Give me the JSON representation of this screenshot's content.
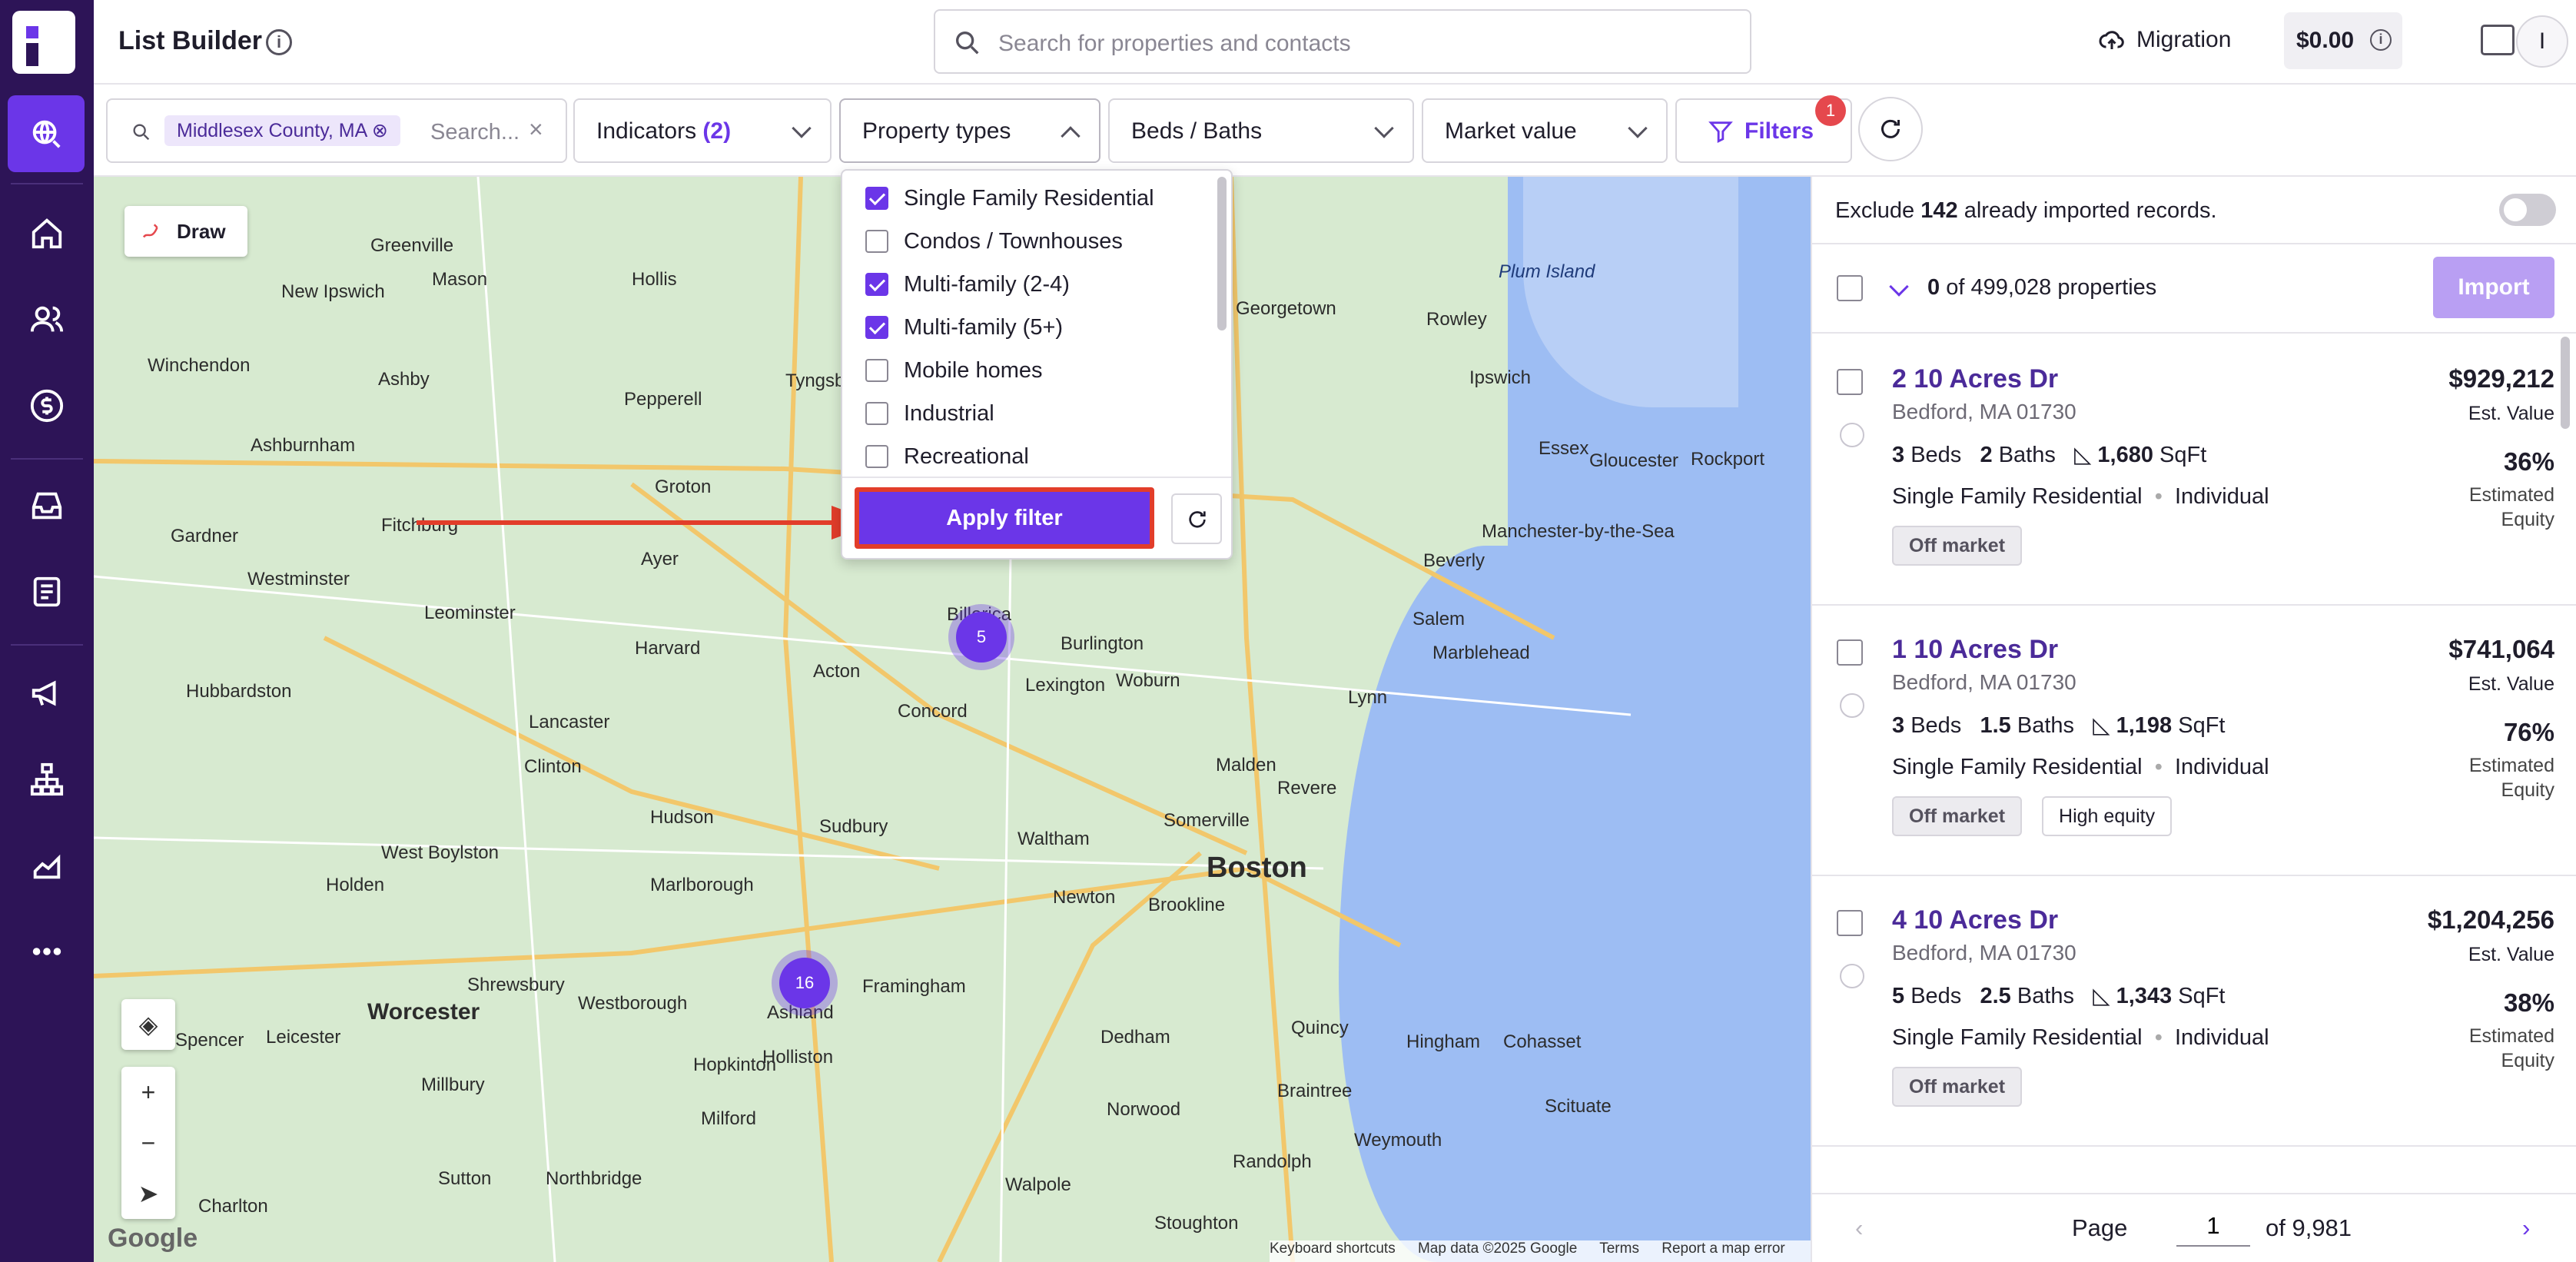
{
  "header": {
    "title": "List Builder",
    "search_placeholder": "Search for properties and contacts",
    "migration_label": "Migration",
    "balance": "$0.00",
    "user_initial": "I"
  },
  "filters": {
    "location_chip": "Middlesex County, MA",
    "location_placeholder": "Search...",
    "indicators_label": "Indicators",
    "indicators_count": "(2)",
    "property_types_label": "Property types",
    "beds_baths_label": "Beds / Baths",
    "market_value_label": "Market value",
    "filters_label": "Filters",
    "filters_badge": "1"
  },
  "dropdown": {
    "options": [
      {
        "label": "Single Family Residential",
        "checked": true
      },
      {
        "label": "Condos / Townhouses",
        "checked": false
      },
      {
        "label": "Multi-family (2-4)",
        "checked": true
      },
      {
        "label": "Multi-family (5+)",
        "checked": true
      },
      {
        "label": "Mobile homes",
        "checked": false
      },
      {
        "label": "Industrial",
        "checked": false
      },
      {
        "label": "Recreational",
        "checked": false
      }
    ],
    "apply_label": "Apply filter"
  },
  "map": {
    "draw_label": "Draw",
    "clusters": [
      {
        "count": "5"
      },
      {
        "count": "16"
      }
    ],
    "labels": [
      "Greenville",
      "New Ipswich",
      "Mason",
      "Hollis",
      "Ashby",
      "Winchendon",
      "Pepperell",
      "Tyngsbo",
      "Ashburnham",
      "Groton",
      "Fitchburg",
      "Gardner",
      "Westminster",
      "Ayer",
      "Leominster",
      "Harvard",
      "Hubbardston",
      "Lancaster",
      "Clinton",
      "Acton",
      "Concord",
      "Lexington",
      "Burlington",
      "Woburn",
      "Billerica",
      "Hudson",
      "Sudbury",
      "Waltham",
      "Marlborough",
      "Newton",
      "Brookline",
      "Boston",
      "Somerville",
      "Malden",
      "Revere",
      "Lynn",
      "Salem",
      "Marblehead",
      "Beverly",
      "Manchester-by-the-Sea",
      "Gloucester",
      "Rockport",
      "Essex",
      "Ipswich",
      "Rowley",
      "Georgetown",
      "Plum Island",
      "West Boylston",
      "Holden",
      "Worcester",
      "Shrewsbury",
      "Westborough",
      "Framingham",
      "Ashland",
      "Hopkinton",
      "Spencer",
      "Leicester",
      "Millbury",
      "Sutton",
      "Northbridge",
      "Charlton",
      "Holliston",
      "Milford",
      "Dedham",
      "Quincy",
      "Hingham",
      "Cohasset",
      "Norwood",
      "Braintree",
      "Walpole",
      "Randolph",
      "Stoughton",
      "Scituate",
      "Weymouth"
    ],
    "attribution": [
      "Keyboard shortcuts",
      "Map data ©2025 Google",
      "Terms",
      "Report a map error"
    ],
    "google": "Google"
  },
  "panel": {
    "exclude_prefix": "Exclude",
    "exclude_count": "142",
    "exclude_suffix": "already imported records.",
    "count_text": "0",
    "count_suffix": "of 499,028 properties",
    "import_label": "Import",
    "properties": [
      {
        "address": "2 10 Acres Dr",
        "city": "Bedford, MA 01730",
        "beds": "3",
        "baths": "2",
        "sqft": "1,680",
        "type": "Single Family Residential",
        "owner": "Individual",
        "price": "$929,212",
        "equity": "36%",
        "tags": [
          "Off market"
        ]
      },
      {
        "address": "1 10 Acres Dr",
        "city": "Bedford, MA 01730",
        "beds": "3",
        "baths": "1.5",
        "sqft": "1,198",
        "type": "Single Family Residential",
        "owner": "Individual",
        "price": "$741,064",
        "equity": "76%",
        "tags": [
          "Off market",
          "High equity"
        ]
      },
      {
        "address": "4 10 Acres Dr",
        "city": "Bedford, MA 01730",
        "beds": "5",
        "baths": "2.5",
        "sqft": "1,343",
        "type": "Single Family Residential",
        "owner": "Individual",
        "price": "$1,204,256",
        "equity": "38%",
        "tags": [
          "Off market"
        ]
      }
    ],
    "labels": {
      "beds": "Beds",
      "baths": "Baths",
      "sqft": "SqFt",
      "est_value": "Est. Value",
      "estimated_equity": "Estimated Equity"
    },
    "pager": {
      "page_label": "Page",
      "page_value": "1",
      "of_label": "of 9,981"
    }
  },
  "colors": {
    "brand": "#6b36e8",
    "rail": "#2d1457",
    "annotation": "#e23d2a"
  }
}
